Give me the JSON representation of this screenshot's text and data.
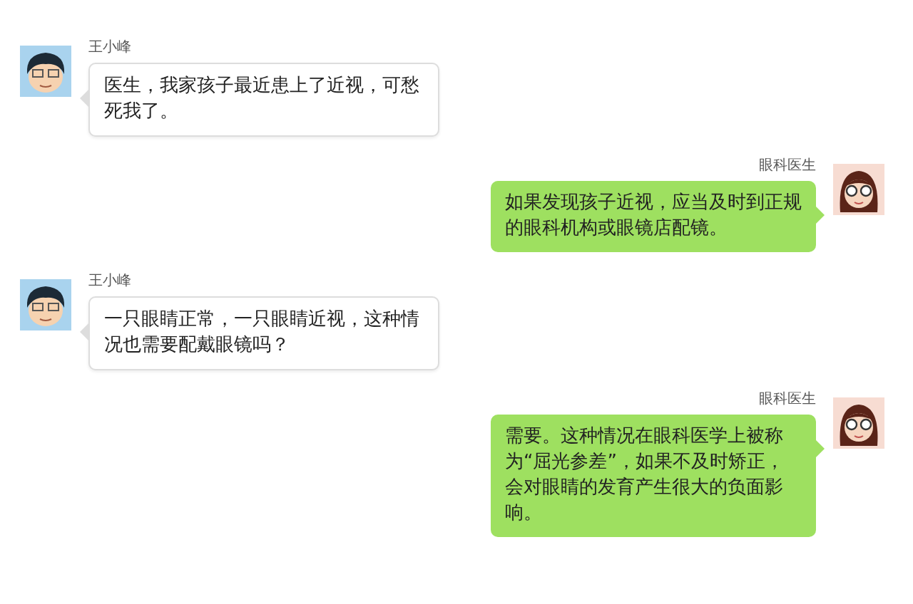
{
  "messages": [
    {
      "kind": "received",
      "sender": "王小峰",
      "text": "医生，我家孩子最近患上了近视，可愁死我了。"
    },
    {
      "kind": "sent",
      "sender": "眼科医生",
      "text": "如果发现孩子近视，应当及时到正规的眼科机构或眼镜店配镜。"
    },
    {
      "kind": "received",
      "sender": "王小峰",
      "text": "一只眼睛正常，一只眼睛近视，这种情况也需要配戴眼镜吗？"
    },
    {
      "kind": "sent",
      "sender": "眼科医生",
      "text": "需要。这种情况在眼科医学上被称为“屈光参差”，如果不及时矫正，会对眼睛的发育产生很大的负面影响。"
    }
  ]
}
